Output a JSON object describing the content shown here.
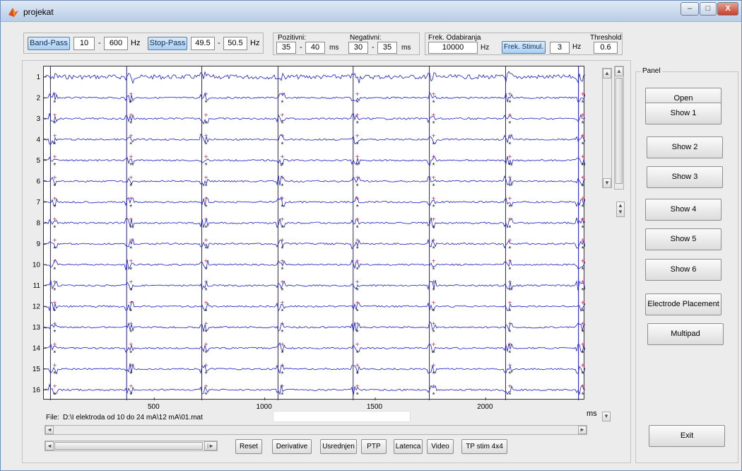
{
  "window": {
    "title": "projekat",
    "minimize_label": "–",
    "maximize_label": "□",
    "close_label": "X"
  },
  "filters": {
    "band_pass_label": "Band-Pass",
    "band_low": "10",
    "band_dash": "-",
    "band_high": "600",
    "band_unit": "Hz",
    "stop_pass_label": "Stop-Pass",
    "stop_low": "49.5",
    "stop_dash": "-",
    "stop_high": "50.5",
    "stop_unit": "Hz"
  },
  "windows": {
    "pozitivni_label": "Pozitivni:",
    "poz_low": "35",
    "poz_dash": "-",
    "poz_high": "40",
    "poz_unit": "ms",
    "negativni_label": "Negativni:",
    "neg_low": "30",
    "neg_dash": "-",
    "neg_high": "35",
    "neg_unit": "ms"
  },
  "sampling": {
    "frek_label": "Frek. Odabiranja",
    "frek_value": "10000",
    "frek_unit": "Hz",
    "stim_label": "Frek. Stimul.",
    "stim_value": "3",
    "stim_unit": "Hz",
    "threshold_label": "Threshold",
    "threshold_value": "0.6"
  },
  "panel": {
    "title": "Panel",
    "open": "Open",
    "show1": "Show 1",
    "show2": "Show 2",
    "show3": "Show 3",
    "show4": "Show 4",
    "show5": "Show 5",
    "show6": "Show 6",
    "electrode": "Electrode Placement",
    "multipad": "Multipad",
    "exit": "Exit"
  },
  "file": {
    "label": "File:",
    "path": "D:\\I elektroda od 10 do 24 mA\\12 mA\\01.mat"
  },
  "bottom_buttons": {
    "reset": "Reset",
    "derivative": "Derivative",
    "usrednjen": "Usrednjen",
    "ptp": "PTP",
    "latenca": "Latenca",
    "video": "Video",
    "tp_stim": "TP stim 4x4"
  },
  "scroll": {
    "up": "▲",
    "down": "▼",
    "left": "◄",
    "right": "►",
    "small_right": "|►"
  },
  "chart_data": {
    "type": "line",
    "x_unit_label": "ms",
    "xlim": [
      0,
      2450
    ],
    "x_ticks": [
      500,
      1000,
      1500,
      2000
    ],
    "channels": [
      "1",
      "2",
      "3",
      "4",
      "5",
      "6",
      "7",
      "8",
      "9",
      "10",
      "11",
      "12",
      "13",
      "14",
      "15",
      "16"
    ],
    "stimulus_times_ms": [
      30,
      375,
      715,
      1060,
      1400,
      1745,
      2090,
      2420
    ],
    "colors": {
      "signal": "#1a1acc",
      "positive_marker": "#e0206a",
      "negative_marker": "#111111",
      "stim_line": "#1a1acc"
    }
  }
}
